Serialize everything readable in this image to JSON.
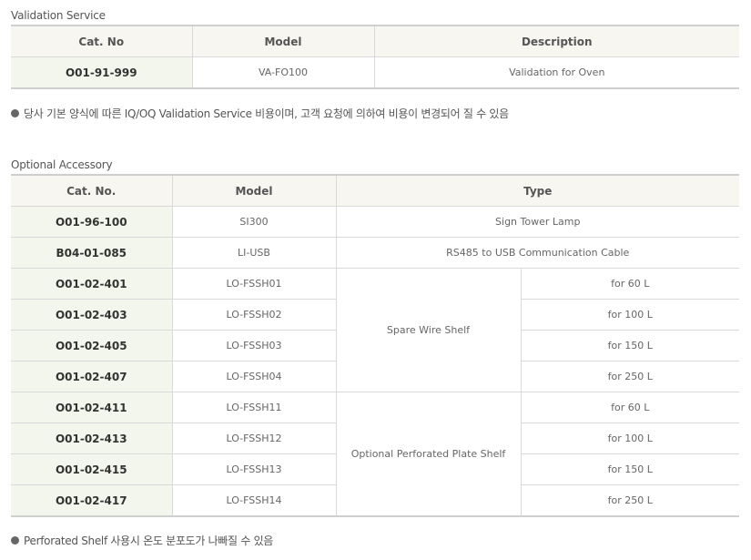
{
  "validation": {
    "title": "Validation Service",
    "headers": {
      "cat": "Cat. No",
      "model": "Model",
      "description": "Description"
    },
    "row": {
      "cat": "O01-91-999",
      "model": "VA-FO100",
      "description": "Validation for Oven"
    },
    "note": "당사 기본 양식에 따른 IQ/OQ Validation Service 비용이며, 고객 요청에 의하여 비용이 변경되어 질 수 있음"
  },
  "accessory": {
    "title": "Optional Accessory",
    "headers": {
      "cat": "Cat. No.",
      "model": "Model",
      "type": "Type"
    },
    "rows": [
      {
        "cat": "O01-96-100",
        "model": "SI300",
        "type": "Sign Tower Lamp"
      },
      {
        "cat": "B04-01-085",
        "model": "LI-USB",
        "type": "RS485 to USB Communication Cable"
      }
    ],
    "groups": [
      {
        "type": "Spare Wire Shelf",
        "rows": [
          {
            "cat": "O01-02-401",
            "model": "LO-FSSH01",
            "size": "for 60 L"
          },
          {
            "cat": "O01-02-403",
            "model": "LO-FSSH02",
            "size": "for 100 L"
          },
          {
            "cat": "O01-02-405",
            "model": "LO-FSSH03",
            "size": "for 150 L"
          },
          {
            "cat": "O01-02-407",
            "model": "LO-FSSH04",
            "size": "for 250 L"
          }
        ]
      },
      {
        "type": "Optional Perforated Plate Shelf",
        "rows": [
          {
            "cat": "O01-02-411",
            "model": "LO-FSSH11",
            "size": "for 60 L"
          },
          {
            "cat": "O01-02-413",
            "model": "LO-FSSH12",
            "size": "for 100 L"
          },
          {
            "cat": "O01-02-415",
            "model": "LO-FSSH13",
            "size": "for 150 L"
          },
          {
            "cat": "O01-02-417",
            "model": "LO-FSSH14",
            "size": "for 250 L"
          }
        ]
      }
    ],
    "note": "Perforated Shelf 사용시 온도 분포도가 나빠질 수 있음"
  }
}
